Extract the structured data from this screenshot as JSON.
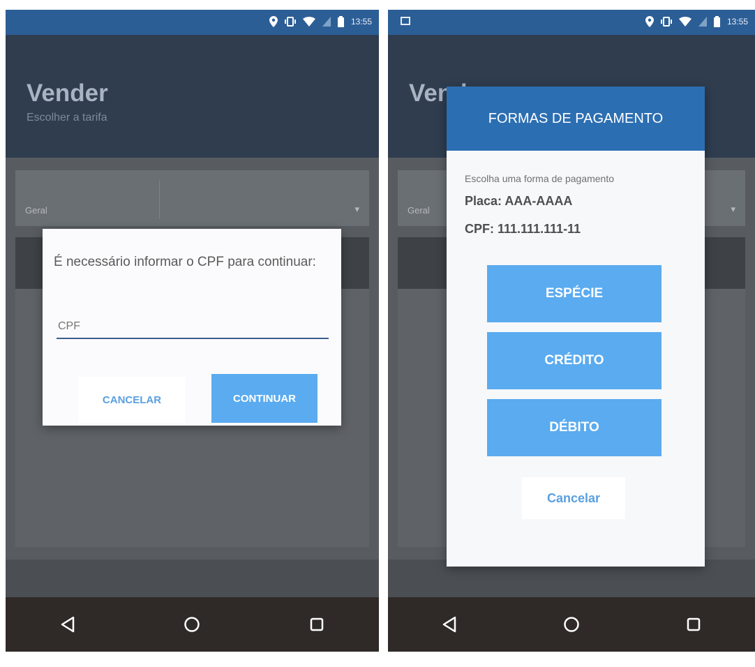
{
  "status_bar": {
    "time": "13:55"
  },
  "left_screen": {
    "app_title": "Vender",
    "app_subtitle": "Escolher a tarifa",
    "field_label": "Geral",
    "dialog": {
      "message": "É necessário informar o CPF para continuar:",
      "input_placeholder": "CPF",
      "cancel_label": "CANCELAR",
      "continue_label": "CONTINUAR"
    }
  },
  "right_screen": {
    "app_title": "Vender",
    "field_label": "Geral",
    "dialog": {
      "title": "FORMAS DE PAGAMENTO",
      "prompt": "Escolha uma forma de pagamento",
      "placa": "Placa: AAA-AAAA",
      "cpf": "CPF: 111.111.111-11",
      "options": [
        "ESPÉCIE",
        "CRÉDITO",
        "DÉBITO"
      ],
      "cancel_label": "Cancelar"
    }
  },
  "colors": {
    "status_bar": "#2c5e96",
    "app_bar": "#2f3d4f",
    "dialog_header": "#2c6eb2",
    "primary_button": "#5aabef",
    "nav_bar": "#2f2a28"
  }
}
